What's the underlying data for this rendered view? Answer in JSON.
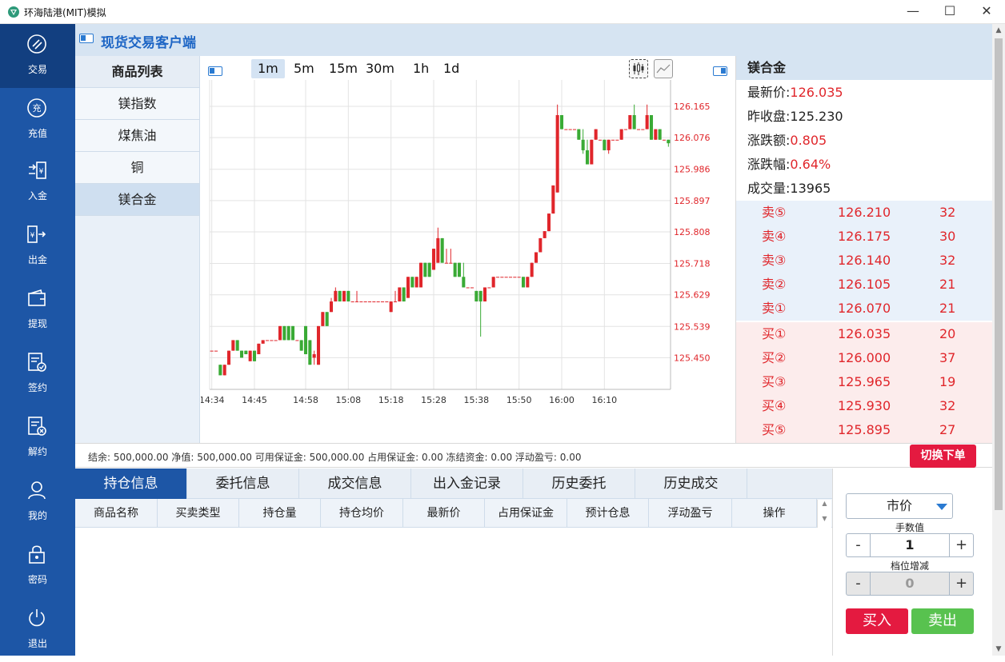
{
  "window": {
    "title": "环海陆港(MIT)模拟",
    "minimize": "—",
    "maximize": "☐",
    "close": "✕"
  },
  "sidebar": {
    "items": [
      {
        "label": "交易",
        "icon": "trade-icon",
        "active": true
      },
      {
        "label": "充值",
        "icon": "recharge-icon"
      },
      {
        "label": "入金",
        "icon": "deposit-icon"
      },
      {
        "label": "出金",
        "icon": "withdraw-icon"
      },
      {
        "label": "提现",
        "icon": "wallet-icon"
      },
      {
        "label": "签约",
        "icon": "sign-icon"
      },
      {
        "label": "解约",
        "icon": "cancel-contract-icon"
      },
      {
        "label": "我的",
        "icon": "user-icon"
      },
      {
        "label": "密码",
        "icon": "lock-icon"
      },
      {
        "label": "退出",
        "icon": "power-icon"
      }
    ]
  },
  "header": {
    "title": "现货交易客户端"
  },
  "product_list": {
    "heading": "商品列表",
    "items": [
      "镁指数",
      "煤焦油",
      "铜",
      "镁合金"
    ],
    "selected": "镁合金"
  },
  "timeframes": {
    "items": [
      "1m",
      "5m",
      "15m",
      "30m",
      "1h",
      "1d"
    ],
    "selected": "1m"
  },
  "chart_data": {
    "type": "candlestick",
    "up_color": "#e0262b",
    "down_color": "#3aaa35",
    "ylim": [
      125.36,
      126.24
    ],
    "y_ticks": [
      "126.165",
      "126.076",
      "125.986",
      "125.897",
      "125.808",
      "125.718",
      "125.629",
      "125.539",
      "125.450"
    ],
    "y_tick_values": [
      126.165,
      126.076,
      125.986,
      125.897,
      125.808,
      125.718,
      125.629,
      125.539,
      125.45
    ],
    "x_ticks": [
      "14:34",
      "14:45",
      "14:58",
      "15:08",
      "15:18",
      "15:28",
      "15:38",
      "15:50",
      "16:00",
      "16:10"
    ],
    "x_tick_index": [
      0,
      10,
      22,
      32,
      42,
      52,
      62,
      72,
      82,
      92
    ],
    "candles": [
      [
        125.47,
        125.47,
        125.47,
        125.47
      ],
      [
        125.47,
        125.47,
        125.47,
        125.47
      ],
      [
        125.43,
        125.43,
        125.4,
        125.4
      ],
      [
        125.4,
        125.43,
        125.4,
        125.43
      ],
      [
        125.43,
        125.47,
        125.43,
        125.47
      ],
      [
        125.47,
        125.5,
        125.47,
        125.5
      ],
      [
        125.5,
        125.5,
        125.47,
        125.47
      ],
      [
        125.47,
        125.47,
        125.45,
        125.45
      ],
      [
        125.47,
        125.47,
        125.46,
        125.46
      ],
      [
        125.44,
        125.47,
        125.44,
        125.47
      ],
      [
        125.47,
        125.47,
        125.44,
        125.44
      ],
      [
        125.46,
        125.49,
        125.46,
        125.49
      ],
      [
        125.49,
        125.5,
        125.49,
        125.5
      ],
      [
        125.5,
        125.5,
        125.5,
        125.5
      ],
      [
        125.5,
        125.5,
        125.5,
        125.5
      ],
      [
        125.5,
        125.5,
        125.5,
        125.5
      ],
      [
        125.5,
        125.54,
        125.5,
        125.54
      ],
      [
        125.54,
        125.54,
        125.5,
        125.5
      ],
      [
        125.54,
        125.54,
        125.5,
        125.5
      ],
      [
        125.54,
        125.54,
        125.5,
        125.5
      ],
      [
        125.5,
        125.5,
        125.5,
        125.5
      ],
      [
        125.5,
        125.5,
        125.47,
        125.47
      ],
      [
        125.54,
        125.54,
        125.46,
        125.46
      ],
      [
        125.5,
        125.5,
        125.43,
        125.43
      ],
      [
        125.45,
        125.47,
        125.43,
        125.46
      ],
      [
        125.43,
        125.54,
        125.43,
        125.54
      ],
      [
        125.54,
        125.58,
        125.54,
        125.58
      ],
      [
        125.58,
        125.58,
        125.54,
        125.54
      ],
      [
        125.58,
        125.62,
        125.58,
        125.61
      ],
      [
        125.61,
        125.65,
        125.61,
        125.64
      ],
      [
        125.64,
        125.64,
        125.61,
        125.61
      ],
      [
        125.61,
        125.64,
        125.61,
        125.64
      ],
      [
        125.64,
        125.64,
        125.61,
        125.61
      ],
      [
        125.61,
        125.61,
        125.61,
        125.61
      ],
      [
        125.61,
        125.64,
        125.61,
        125.61
      ],
      [
        125.61,
        125.61,
        125.61,
        125.61
      ],
      [
        125.61,
        125.61,
        125.61,
        125.61
      ],
      [
        125.61,
        125.61,
        125.61,
        125.61
      ],
      [
        125.61,
        125.61,
        125.61,
        125.61
      ],
      [
        125.61,
        125.61,
        125.61,
        125.61
      ],
      [
        125.61,
        125.61,
        125.61,
        125.61
      ],
      [
        125.61,
        125.61,
        125.61,
        125.61
      ],
      [
        125.58,
        125.61,
        125.58,
        125.61
      ],
      [
        125.61,
        125.64,
        125.61,
        125.61
      ],
      [
        125.61,
        125.65,
        125.61,
        125.65
      ],
      [
        125.65,
        125.65,
        125.61,
        125.61
      ],
      [
        125.62,
        125.68,
        125.62,
        125.68
      ],
      [
        125.68,
        125.68,
        125.65,
        125.65
      ],
      [
        125.65,
        125.68,
        125.65,
        125.68
      ],
      [
        125.65,
        125.72,
        125.65,
        125.72
      ],
      [
        125.72,
        125.72,
        125.68,
        125.68
      ],
      [
        125.72,
        125.72,
        125.68,
        125.68
      ],
      [
        125.7,
        125.76,
        125.7,
        125.76
      ],
      [
        125.72,
        125.82,
        125.72,
        125.79
      ],
      [
        125.79,
        125.79,
        125.72,
        125.72
      ],
      [
        125.72,
        125.76,
        125.72,
        125.72
      ],
      [
        125.72,
        125.76,
        125.72,
        125.72
      ],
      [
        125.72,
        125.72,
        125.68,
        125.68
      ],
      [
        125.72,
        125.72,
        125.68,
        125.68
      ],
      [
        125.68,
        125.72,
        125.65,
        125.65
      ],
      [
        125.65,
        125.65,
        125.65,
        125.65
      ],
      [
        125.65,
        125.65,
        125.65,
        125.65
      ],
      [
        125.64,
        125.64,
        125.61,
        125.61
      ],
      [
        125.64,
        125.64,
        125.51,
        125.61
      ],
      [
        125.61,
        125.65,
        125.61,
        125.65
      ],
      [
        125.65,
        125.65,
        125.65,
        125.65
      ],
      [
        125.65,
        125.68,
        125.65,
        125.68
      ],
      [
        125.68,
        125.68,
        125.68,
        125.68
      ],
      [
        125.68,
        125.68,
        125.68,
        125.68
      ],
      [
        125.68,
        125.68,
        125.68,
        125.68
      ],
      [
        125.68,
        125.68,
        125.68,
        125.68
      ],
      [
        125.68,
        125.68,
        125.68,
        125.68
      ],
      [
        125.68,
        125.68,
        125.68,
        125.68
      ],
      [
        125.68,
        125.68,
        125.65,
        125.65
      ],
      [
        125.65,
        125.68,
        125.65,
        125.68
      ],
      [
        125.68,
        125.72,
        125.68,
        125.72
      ],
      [
        125.72,
        125.75,
        125.72,
        125.75
      ],
      [
        125.75,
        125.79,
        125.75,
        125.79
      ],
      [
        125.79,
        125.81,
        125.79,
        125.81
      ],
      [
        125.81,
        125.86,
        125.81,
        125.86
      ],
      [
        125.86,
        125.94,
        125.86,
        125.94
      ],
      [
        125.92,
        126.17,
        125.92,
        126.14
      ],
      [
        126.14,
        126.14,
        126.1,
        126.1
      ],
      [
        126.1,
        126.1,
        126.1,
        126.1
      ],
      [
        126.1,
        126.1,
        126.1,
        126.1
      ],
      [
        126.1,
        126.1,
        126.1,
        126.1
      ],
      [
        126.1,
        126.1,
        126.07,
        126.07
      ],
      [
        126.07,
        126.1,
        126.03,
        126.04
      ],
      [
        126.04,
        126.07,
        126.0,
        126.0
      ],
      [
        126.0,
        126.07,
        126.0,
        126.07
      ],
      [
        126.07,
        126.1,
        126.07,
        126.1
      ],
      [
        126.07,
        126.07,
        126.07,
        126.07
      ],
      [
        126.07,
        126.07,
        126.04,
        126.04
      ],
      [
        126.04,
        126.07,
        126.03,
        126.07
      ],
      [
        126.07,
        126.07,
        126.07,
        126.07
      ],
      [
        126.07,
        126.07,
        126.07,
        126.07
      ],
      [
        126.07,
        126.1,
        126.07,
        126.1
      ],
      [
        126.1,
        126.1,
        126.1,
        126.1
      ],
      [
        126.1,
        126.14,
        126.1,
        126.14
      ],
      [
        126.14,
        126.17,
        126.1,
        126.1
      ],
      [
        126.1,
        126.1,
        126.1,
        126.1
      ],
      [
        126.1,
        126.1,
        126.1,
        126.1
      ],
      [
        126.1,
        126.17,
        126.1,
        126.14
      ],
      [
        126.14,
        126.14,
        126.07,
        126.07
      ],
      [
        126.07,
        126.1,
        126.07,
        126.1
      ],
      [
        126.1,
        126.1,
        126.07,
        126.07
      ],
      [
        126.07,
        126.07,
        126.07,
        126.07
      ],
      [
        126.07,
        126.07,
        126.05,
        126.06
      ]
    ]
  },
  "quote": {
    "name": "镁合金",
    "last_label": "最新价:",
    "last": "126.035",
    "prev_label": "昨收盘:",
    "prev": "125.230",
    "chg_label": "涨跌额:",
    "chg": "0.805",
    "pct_label": "涨跌幅:",
    "pct": "0.64%",
    "vol_label": "成交量:",
    "vol": "13965",
    "asks": [
      {
        "name": "卖⑤",
        "price": "126.210",
        "qty": "32"
      },
      {
        "name": "卖④",
        "price": "126.175",
        "qty": "30"
      },
      {
        "name": "卖③",
        "price": "126.140",
        "qty": "32"
      },
      {
        "name": "卖②",
        "price": "126.105",
        "qty": "21"
      },
      {
        "name": "卖①",
        "price": "126.070",
        "qty": "21"
      }
    ],
    "bids": [
      {
        "name": "买①",
        "price": "126.035",
        "qty": "20"
      },
      {
        "name": "买②",
        "price": "126.000",
        "qty": "37"
      },
      {
        "name": "买③",
        "price": "125.965",
        "qty": "19"
      },
      {
        "name": "买④",
        "price": "125.930",
        "qty": "32"
      },
      {
        "name": "买⑤",
        "price": "125.895",
        "qty": "27"
      }
    ]
  },
  "status": {
    "text": "结余: 500,000.00  净值: 500,000.00  可用保证金: 500,000.00  占用保证金: 0.00  冻结资金: 0.00  浮动盈亏: 0.00",
    "switch_button": "切换下单"
  },
  "tabs": [
    "持仓信息",
    "委托信息",
    "成交信息",
    "出入金记录",
    "历史委托",
    "历史成交"
  ],
  "columns": [
    "商品名称",
    "买卖类型",
    "持仓量",
    "持仓均价",
    "最新价",
    "占用保证金",
    "预计仓息",
    "浮动盈亏",
    "操作"
  ],
  "order": {
    "type": "市价",
    "lots_label": "手数值",
    "lots": "1",
    "step_label": "档位增减",
    "step": "0",
    "minus": "-",
    "plus": "+",
    "buy": "买入",
    "sell": "卖出"
  }
}
